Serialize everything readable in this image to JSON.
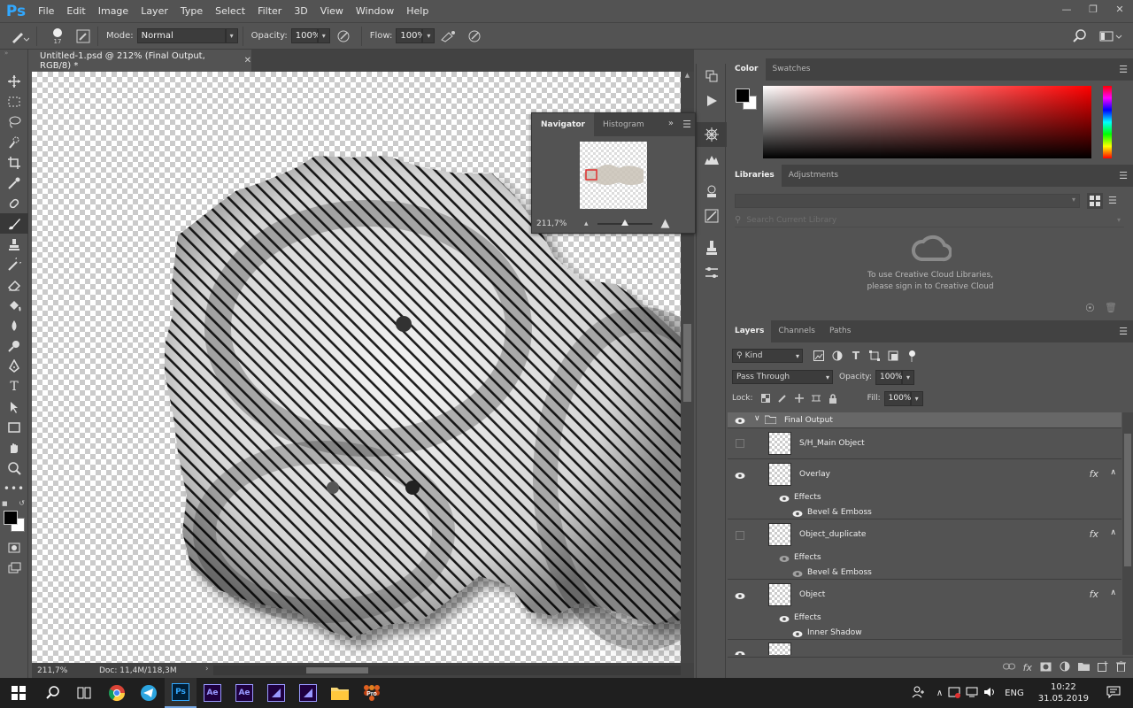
{
  "app": {
    "logo": "Ps",
    "menu": [
      "File",
      "Edit",
      "Image",
      "Layer",
      "Type",
      "Select",
      "Filter",
      "3D",
      "View",
      "Window",
      "Help"
    ]
  },
  "options": {
    "brush_size": "17",
    "mode_label": "Mode:",
    "mode_value": "Normal",
    "opacity_label": "Opacity:",
    "opacity_value": "100%",
    "flow_label": "Flow:",
    "flow_value": "100%"
  },
  "document": {
    "tab_title": "Untitled-1.psd @ 212% (Final Output, RGB/8) *",
    "zoom": "211,7%",
    "doc_info": "Doc: 11,4M/118,3M"
  },
  "navigator": {
    "tabs": [
      "Navigator",
      "Histogram"
    ],
    "zoom": "211,7%",
    "zoom_level": 0.5
  },
  "color_panel": {
    "tabs": [
      "Color",
      "Swatches"
    ],
    "foreground": "#000000",
    "background": "#ffffff",
    "hue": "#ff0000"
  },
  "libraries": {
    "tabs": [
      "Libraries",
      "Adjustments"
    ],
    "search_placeholder": "Search Current Library",
    "message_line1": "To use Creative Cloud Libraries,",
    "message_line2": "please sign in to Creative Cloud"
  },
  "layers_panel": {
    "tabs": [
      "Layers",
      "Channels",
      "Paths"
    ],
    "filter_kind": "Kind",
    "blend_mode": "Pass Through",
    "opacity_label": "Opacity:",
    "opacity_value": "100%",
    "lock_label": "Lock:",
    "fill_label": "Fill:",
    "fill_value": "100%",
    "group_name": "Final Output",
    "layers": [
      {
        "name": "S/H_Main Object",
        "visible": false
      },
      {
        "name": "Overlay",
        "visible": true,
        "effects_label": "Effects",
        "effect": "Bevel & Emboss"
      },
      {
        "name": "Object_duplicate",
        "visible": false,
        "effects_label": "Effects",
        "effect": "Bevel & Emboss"
      },
      {
        "name": "Object",
        "visible": true,
        "effects_label": "Effects",
        "effect": "Inner Shadow"
      }
    ]
  },
  "taskbar": {
    "language": "ENG",
    "time": "10:22",
    "date": "31.05.2019"
  }
}
